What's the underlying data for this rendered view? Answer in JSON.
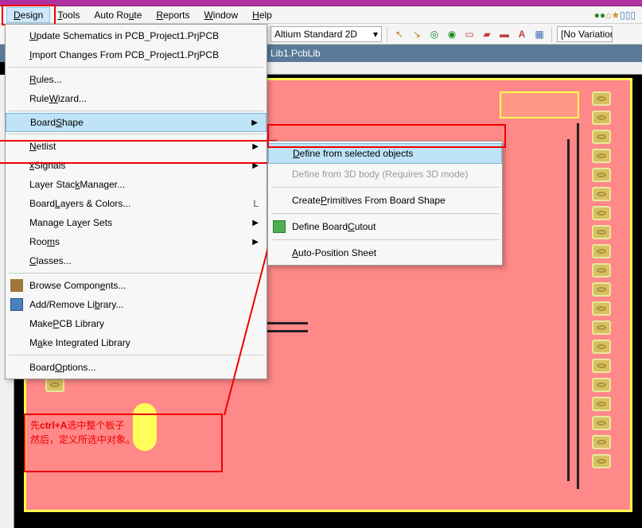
{
  "menubar": {
    "design": "Design",
    "tools": "Tools",
    "autoroute": "Auto Route",
    "reports": "Reports",
    "window": "Window",
    "help": "Help"
  },
  "toolbar": {
    "view_mode": "Altium Standard 2D",
    "variation": "[No Variation"
  },
  "tabbar": {
    "tab": "Lib1.PcbLib"
  },
  "design_menu": {
    "update_schematic": "Update Schematics in PCB_Project1.PrjPCB",
    "import_changes": "Import Changes From PCB_Project1.PrjPCB",
    "rules": "Rules...",
    "rule_wizard": "Rule Wizard...",
    "board_shape": "Board Shape",
    "netlist": "Netlist",
    "xsignals": "xSignals",
    "layer_stack": "Layer Stack Manager...",
    "board_layers": "Board Layers & Colors...",
    "board_layers_shortcut": "L",
    "manage_layer_sets": "Manage Layer Sets",
    "rooms": "Rooms",
    "classes": "Classes...",
    "browse_components": "Browse Components...",
    "add_remove_library": "Add/Remove Library...",
    "make_pcb_library": "Make PCB Library",
    "make_integrated_library": "Make Integrated Library",
    "board_options": "Board Options..."
  },
  "board_shape_submenu": {
    "define_selected": "Define from selected objects",
    "define_3d": "Define from 3D body (Requires 3D mode)",
    "create_primitives": "Create Primitives From Board Shape",
    "define_cutout": "Define Board Cutout",
    "auto_position": "Auto-Position Sheet"
  },
  "annotation": {
    "line1_a": "先",
    "line1_b": "ctrl+A",
    "line1_c": "选中整个板子",
    "line2": "然后，定义所选中对象。"
  }
}
